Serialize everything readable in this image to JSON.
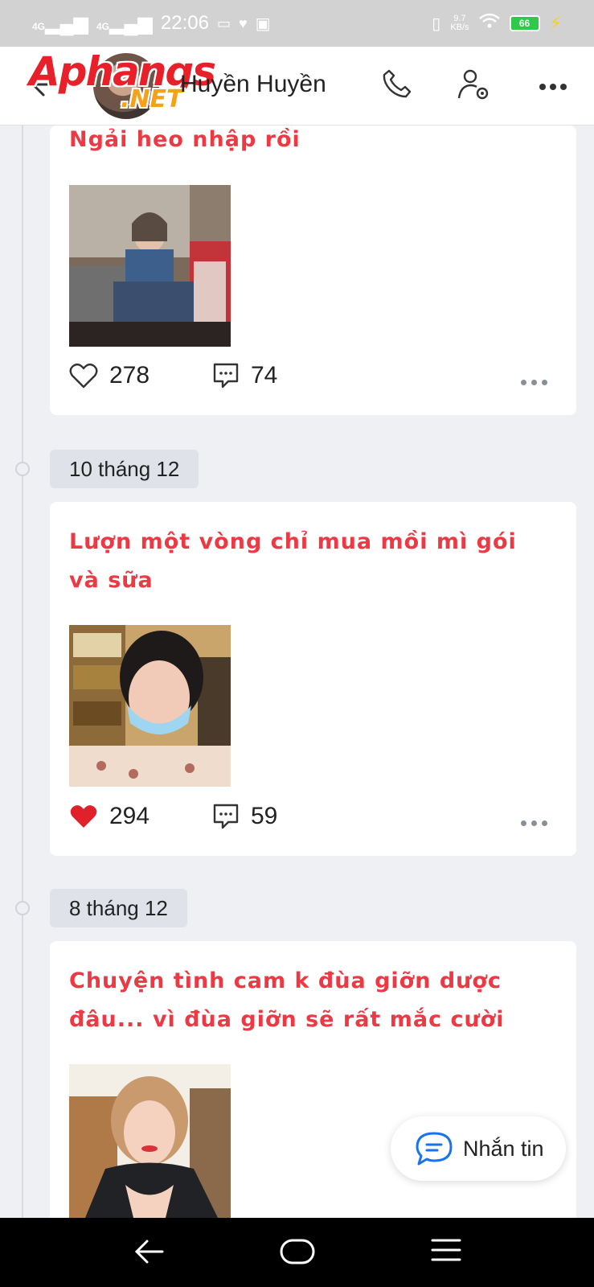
{
  "status_bar": {
    "time": "22:06",
    "net1": "4G",
    "net2": "4G",
    "speed": "9.7",
    "speed_unit": "KB/s",
    "battery": "66"
  },
  "header": {
    "title": "Huyền Huyền",
    "logo_main": "Aphangs",
    "logo_sub": ".NET"
  },
  "posts": [
    {
      "title_lines": [
        "Ngải heo nhập rồi"
      ],
      "likes": "278",
      "comments": "74",
      "liked": false
    },
    {
      "date": "10 tháng 12",
      "title_lines": [
        "Lượn một vòng chỉ mua mồi mì gói",
        "và sữa"
      ],
      "likes": "294",
      "comments": "59",
      "liked": true
    },
    {
      "date": "8 tháng 12",
      "title_lines": [
        "Chuyện tình cam k đùa giỡn dược",
        "đâu... vì đùa giỡn sẽ rất mắc cười"
      ]
    }
  ],
  "message_button": {
    "label": "Nhắn tin"
  },
  "colors": {
    "title_red": "#ec3a44",
    "heart_red": "#e0202a",
    "accent_blue": "#1a73e8"
  }
}
